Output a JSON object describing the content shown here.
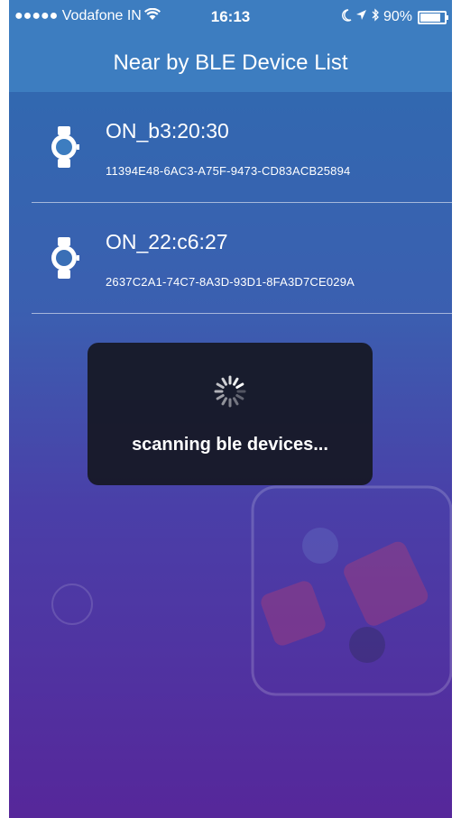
{
  "status_bar": {
    "carrier": "●●●●● Vodafone IN",
    "time": "16:13",
    "battery": "90%",
    "battery_level": 0.9
  },
  "nav": {
    "title": "Near by BLE Device List"
  },
  "devices": [
    {
      "name": "ON_b3:20:30",
      "uuid": "11394E48-6AC3-A75F-9473-CD83ACB25894",
      "icon": "watch-icon"
    },
    {
      "name": "ON_22:c6:27",
      "uuid": "2637C2A1-74C7-8A3D-93D1-8FA3D7CE029A",
      "icon": "watch-icon"
    }
  ],
  "hud": {
    "message": "scanning ble devices...",
    "icon": "spinner-icon"
  },
  "colors": {
    "bar": "#3d7dc0",
    "gradient_top": "#2e6cb0",
    "gradient_bottom": "#56279a"
  }
}
